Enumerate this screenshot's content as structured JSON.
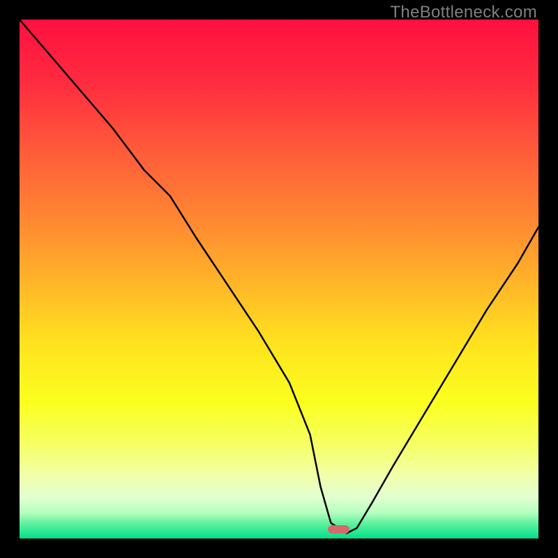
{
  "watermark": {
    "text": "TheBottleneck.com"
  },
  "gradient": {
    "stops": [
      {
        "pct": 0,
        "color": "#ff103f"
      },
      {
        "pct": 12,
        "color": "#ff2b3f"
      },
      {
        "pct": 25,
        "color": "#ff5a3a"
      },
      {
        "pct": 38,
        "color": "#ff8532"
      },
      {
        "pct": 50,
        "color": "#ffb229"
      },
      {
        "pct": 62,
        "color": "#ffe11f"
      },
      {
        "pct": 74,
        "color": "#fbff1f"
      },
      {
        "pct": 82,
        "color": "#f6ff66"
      },
      {
        "pct": 88,
        "color": "#f1ffab"
      },
      {
        "pct": 92,
        "color": "#e2ffd0"
      },
      {
        "pct": 95,
        "color": "#b6ffbf"
      },
      {
        "pct": 97,
        "color": "#63f2a0"
      },
      {
        "pct": 100,
        "color": "#00e08a"
      }
    ]
  },
  "marker": {
    "x_pct": 61.5,
    "y_pct": 98.2,
    "w_pct": 4.2,
    "h_pct": 1.6,
    "color": "#d46a6a"
  },
  "chart_data": {
    "type": "line",
    "title": "",
    "xlabel": "",
    "ylabel": "",
    "xlim": [
      0,
      100
    ],
    "ylim": [
      0,
      100
    ],
    "series": [
      {
        "name": "bottleneck-curve",
        "x": [
          0,
          6,
          12,
          18,
          24,
          29,
          34,
          40,
          46,
          52,
          56,
          58,
          60,
          63,
          65,
          68,
          72,
          78,
          84,
          90,
          96,
          100
        ],
        "y": [
          100,
          93,
          86,
          79,
          71,
          66,
          58,
          49,
          40,
          30,
          20,
          10,
          3,
          1,
          2,
          7,
          14,
          24,
          34,
          44,
          53,
          60
        ]
      }
    ],
    "annotations": [
      {
        "type": "marker",
        "x": 61.5,
        "y": 1.8,
        "label": "optimal-point"
      }
    ],
    "grid": false,
    "legend": false
  }
}
